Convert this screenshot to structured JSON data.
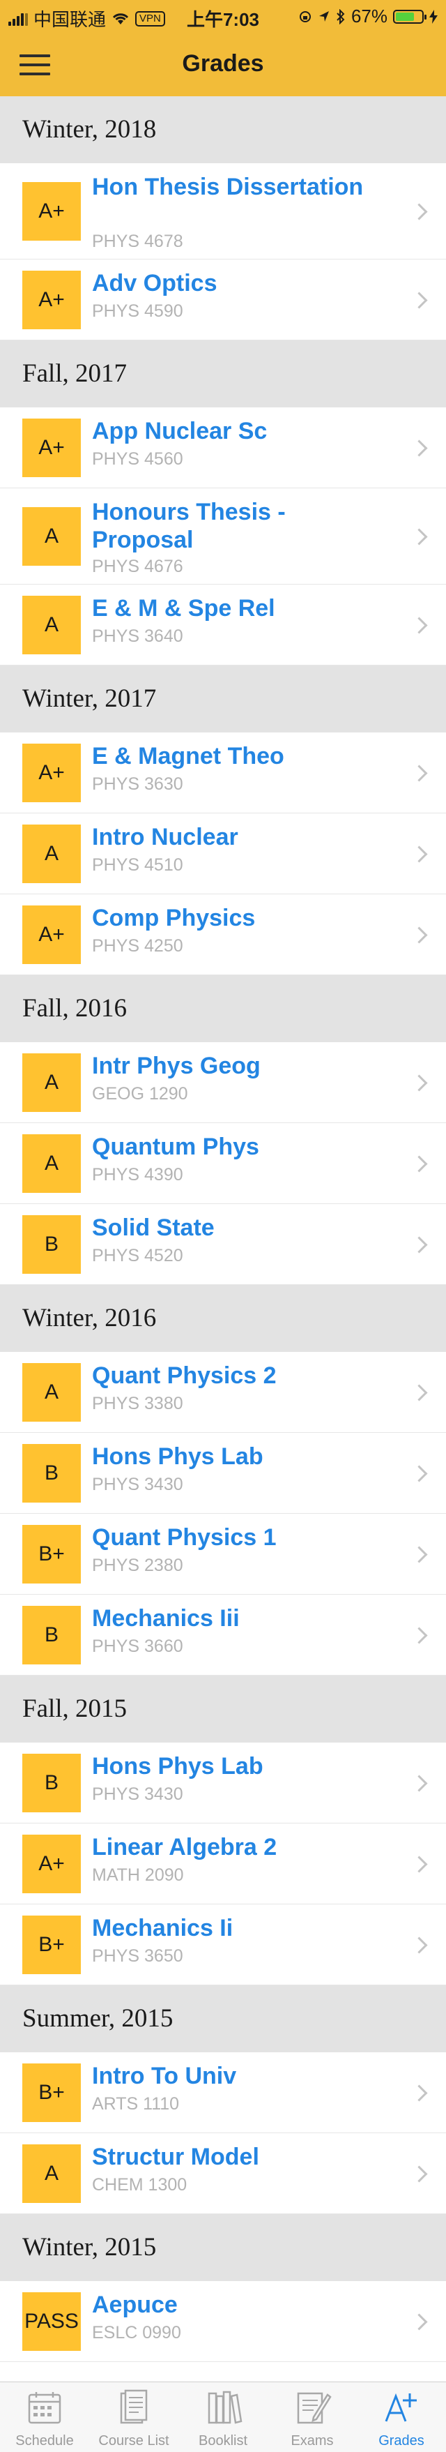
{
  "status_bar": {
    "carrier": "中国联通",
    "vpn": "VPN",
    "time": "上午7:03",
    "battery": "67%",
    "battery_level": 0.67
  },
  "nav": {
    "title": "Grades",
    "menu_icon": "hamburger-menu-icon"
  },
  "sections": [
    {
      "term": "Winter, 2018",
      "courses": [
        {
          "grade": "A+",
          "title": "Hon Thesis Dissertation",
          "code": "PHYS 4678"
        },
        {
          "grade": "A+",
          "title": "Adv Optics",
          "code": "PHYS 4590"
        }
      ]
    },
    {
      "term": "Fall, 2017",
      "courses": [
        {
          "grade": "A+",
          "title": "App Nuclear Sc",
          "code": "PHYS 4560"
        },
        {
          "grade": "A",
          "title": "Honours Thesis - Proposal",
          "code": "PHYS 4676"
        },
        {
          "grade": "A",
          "title": "E & M & Spe Rel",
          "code": "PHYS 3640"
        }
      ]
    },
    {
      "term": "Winter, 2017",
      "courses": [
        {
          "grade": "A+",
          "title": "E & Magnet Theo",
          "code": "PHYS 3630"
        },
        {
          "grade": "A",
          "title": "Intro Nuclear",
          "code": "PHYS 4510"
        },
        {
          "grade": "A+",
          "title": "Comp Physics",
          "code": "PHYS 4250"
        }
      ]
    },
    {
      "term": "Fall, 2016",
      "courses": [
        {
          "grade": "A",
          "title": "Intr Phys Geog",
          "code": "GEOG 1290"
        },
        {
          "grade": "A",
          "title": "Quantum Phys",
          "code": "PHYS 4390"
        },
        {
          "grade": "B",
          "title": "Solid State",
          "code": "PHYS 4520"
        }
      ]
    },
    {
      "term": "Winter, 2016",
      "courses": [
        {
          "grade": "A",
          "title": "Quant Physics 2",
          "code": "PHYS 3380"
        },
        {
          "grade": "B",
          "title": "Hons Phys Lab",
          "code": "PHYS 3430"
        },
        {
          "grade": "B+",
          "title": "Quant Physics 1",
          "code": "PHYS 2380"
        },
        {
          "grade": "B",
          "title": "Mechanics Iii",
          "code": "PHYS 3660"
        }
      ]
    },
    {
      "term": "Fall, 2015",
      "courses": [
        {
          "grade": "B",
          "title": "Hons Phys Lab",
          "code": "PHYS 3430"
        },
        {
          "grade": "A+",
          "title": "Linear Algebra 2",
          "code": "MATH 2090"
        },
        {
          "grade": "B+",
          "title": "Mechanics Ii",
          "code": "PHYS 3650"
        }
      ]
    },
    {
      "term": "Summer, 2015",
      "courses": [
        {
          "grade": "B+",
          "title": "Intro To Univ",
          "code": "ARTS 1110"
        },
        {
          "grade": "A",
          "title": "Structur Model",
          "code": "CHEM 1300"
        }
      ]
    },
    {
      "term": "Winter, 2015",
      "courses": [
        {
          "grade": "PASS",
          "title": "Aepuce",
          "code": "ESLC 0990"
        }
      ]
    }
  ],
  "tabs": [
    {
      "label": "Schedule",
      "icon": "calendar-icon",
      "active": false
    },
    {
      "label": "Course List",
      "icon": "document-list-icon",
      "active": false
    },
    {
      "label": "Booklist",
      "icon": "books-icon",
      "active": false
    },
    {
      "label": "Exams",
      "icon": "exam-paper-icon",
      "active": false
    },
    {
      "label": "Grades",
      "icon": "a-plus-icon",
      "active": true
    }
  ],
  "colors": {
    "accent": "#F2BC39",
    "badge": "#FFC230",
    "link": "#2385E2",
    "section_bg": "#E3E3E3"
  }
}
